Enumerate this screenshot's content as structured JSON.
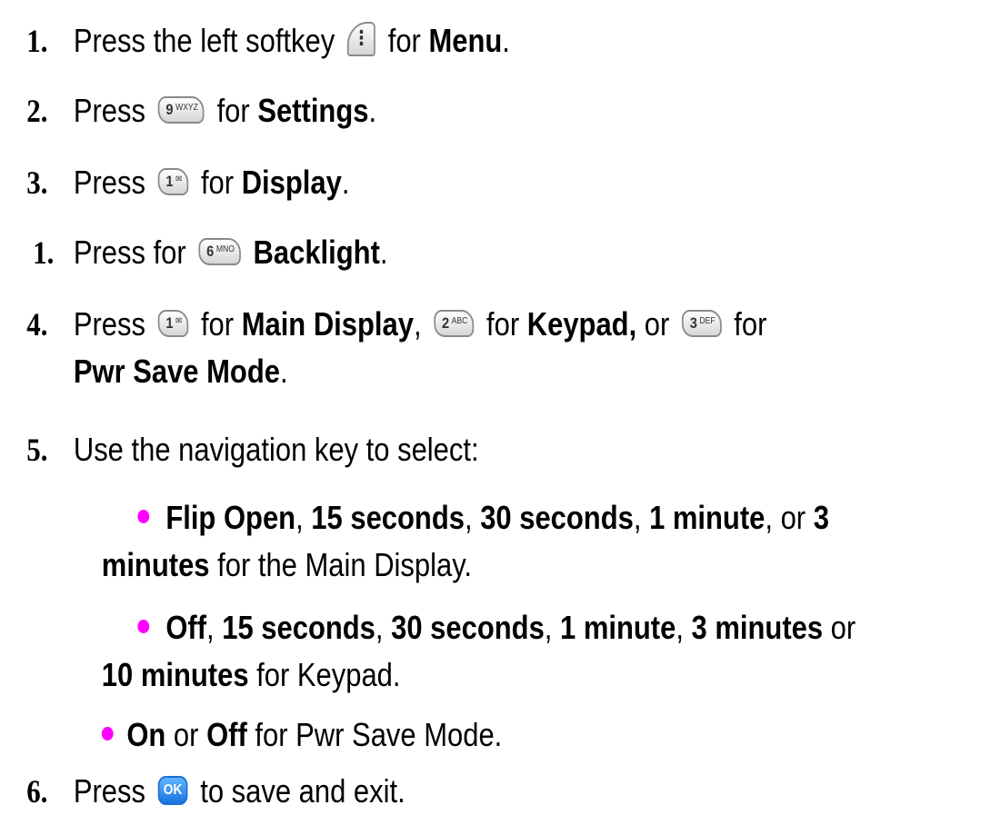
{
  "steps": [
    {
      "number": "1.",
      "pre": "Press the left softkey",
      "key": {
        "label": "⋮",
        "icon": "left-softkey-icon"
      },
      "mid": "for",
      "bold": "Menu",
      "end": "."
    },
    {
      "number": "2.",
      "pre": "Press",
      "key": {
        "label": "9",
        "sub": "WXYZ",
        "icon": "key-9-icon"
      },
      "mid": "for",
      "bold": "Settings",
      "end": "."
    },
    {
      "number": "3.",
      "pre": "Press",
      "key": {
        "label": "1",
        "sub": "✉",
        "icon": "key-1-icon"
      },
      "mid": "for",
      "bold": "Display",
      "end": "."
    },
    {
      "number": "1.",
      "pre": "Press for",
      "key": {
        "label": "6",
        "sub": "MNO",
        "icon": "key-6-icon"
      },
      "bold": "Backlight",
      "end": "."
    },
    {
      "number": "4.",
      "pre": "Press",
      "key1": {
        "label": "1",
        "sub": "✉",
        "icon": "key-1-icon"
      },
      "mid1": "for",
      "bold1": "Main Display",
      "sep1": ",",
      "key2": {
        "label": "2",
        "sub": "ABC",
        "icon": "key-2-icon"
      },
      "mid2": "for",
      "bold2": "Keypad,",
      "or": "or",
      "key3": {
        "label": "3",
        "sub": "DEF",
        "icon": "key-3-icon"
      },
      "mid3": "for",
      "bold3": "Pwr Save Mode",
      "end": "."
    },
    {
      "number": "5.",
      "text": "Use the navigation key to select:"
    },
    {
      "number": "6.",
      "pre": "Press",
      "key": {
        "label": "OK",
        "icon": "ok-key-icon"
      },
      "mid": "to save and exit."
    }
  ],
  "bullets": [
    {
      "o1": "Flip Open",
      "c1": ",",
      "o2": "15 seconds",
      "c2": ",",
      "o3": "30 seconds",
      "c3": ",",
      "o4": "1 minute",
      "c4": ", or",
      "o5": "3",
      "o5b": "minutes",
      "tail": "for the Main Display."
    },
    {
      "o1": "Off",
      "c1": ",",
      "o2": "15 seconds",
      "c2": ",",
      "o3": "30 seconds",
      "c3": ",",
      "o4": "1 minute",
      "c4": ",",
      "o5": "3 minutes",
      "c5": "or",
      "o6": "10 minutes",
      "tail": "for Keypad."
    },
    {
      "o1": "On",
      "c1": "or",
      "o2": "Off",
      "tail": "for Pwr Save Mode."
    }
  ],
  "colors": {
    "bullet": "#ff00ff",
    "ok_key": "#1a73e0"
  }
}
